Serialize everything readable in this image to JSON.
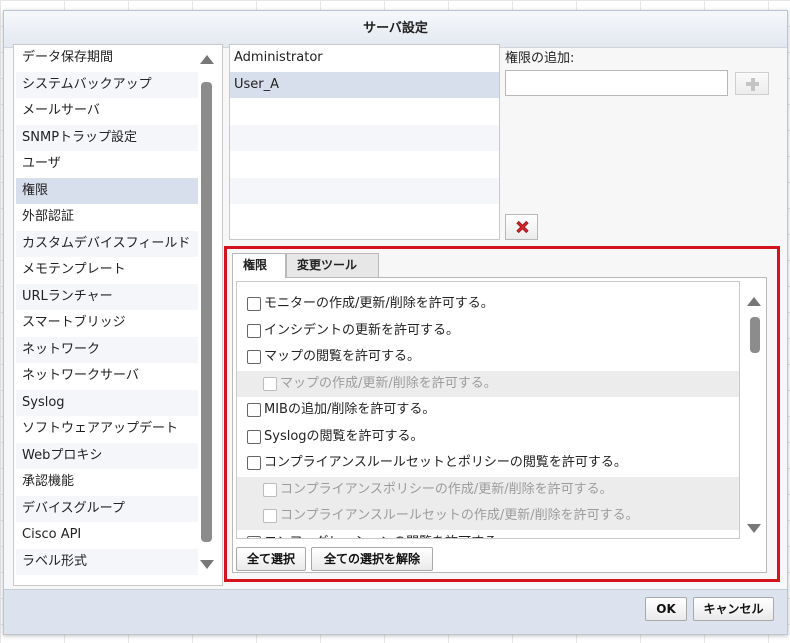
{
  "dialog": {
    "title": "サーバ設定"
  },
  "nav": {
    "items": [
      "データ保存期間",
      "システムバックアップ",
      "メールサーバ",
      "SNMPトラップ設定",
      "ユーザ",
      "権限",
      "外部認証",
      "カスタムデバイスフィールド",
      "メモテンプレート",
      "URLランチャー",
      "スマートブリッジ",
      "ネットワーク",
      "ネットワークサーバ",
      "Syslog",
      "ソフトウェアアップデート",
      "Webプロキシ",
      "承認機能",
      "デバイスグループ",
      "Cisco API",
      "ラベル形式"
    ],
    "selected_index": 5
  },
  "users": {
    "rows": [
      "Administrator",
      "User_A"
    ],
    "selected_index": 1
  },
  "add_permission": {
    "label": "権限の追加:",
    "value": "",
    "add_icon": "plus-icon",
    "delete_icon": "red-x-icon"
  },
  "tabs": [
    "権限",
    "変更ツール"
  ],
  "active_tab": 0,
  "permissions": [
    {
      "label": "モニターの作成/更新/削除を許可する。",
      "sub": false,
      "checked": false
    },
    {
      "label": "インシデントの更新を許可する。",
      "sub": false,
      "checked": false
    },
    {
      "label": "マップの閲覧を許可する。",
      "sub": false,
      "checked": false
    },
    {
      "label": "マップの作成/更新/削除を許可する。",
      "sub": true,
      "checked": false
    },
    {
      "label": "MIBの追加/削除を許可する。",
      "sub": false,
      "checked": false
    },
    {
      "label": "Syslogの閲覧を許可する。",
      "sub": false,
      "checked": false
    },
    {
      "label": "コンプライアンスルールセットとポリシーの閲覧を許可する。",
      "sub": false,
      "checked": false
    },
    {
      "label": "コンプライアンスポリシーの作成/更新/削除を許可する。",
      "sub": true,
      "checked": false
    },
    {
      "label": "コンプライアンスルールセットの作成/更新/削除を許可する。",
      "sub": true,
      "checked": false
    },
    {
      "label": "コンフィグレーションの閲覧を許可する。",
      "sub": false,
      "checked": false
    }
  ],
  "buttons": {
    "select_all": "全て選択",
    "deselect_all": "全ての選択を解除",
    "ok": "OK",
    "cancel": "キャンセル"
  },
  "colors": {
    "highlight": "#d4141c",
    "selected_row": "#d7dfec"
  }
}
